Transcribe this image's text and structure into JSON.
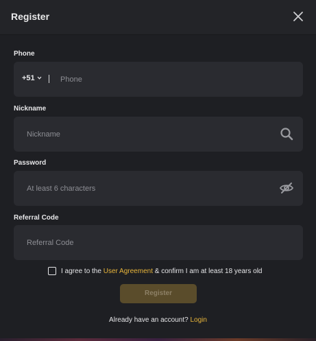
{
  "header": {
    "title": "Register"
  },
  "phone": {
    "label": "Phone",
    "country_code": "+51",
    "placeholder": "Phone"
  },
  "nickname": {
    "label": "Nickname",
    "placeholder": "Nickname"
  },
  "password": {
    "label": "Password",
    "placeholder": "At least 6 characters"
  },
  "referral": {
    "label": "Referral Code",
    "placeholder": "Referral Code"
  },
  "agreement": {
    "prefix": "I agree to the ",
    "link": "User Agreement",
    "suffix": " & confirm I am at least 18 years old",
    "checked": false
  },
  "register_button": {
    "label": "Register"
  },
  "login_prompt": {
    "text": "Already have an account? ",
    "link": "Login"
  },
  "colors": {
    "accent": "#e8b53b",
    "button_bg": "#5a4c2b",
    "modal_bg": "#1e1f23",
    "field_bg": "#2a2b30"
  }
}
